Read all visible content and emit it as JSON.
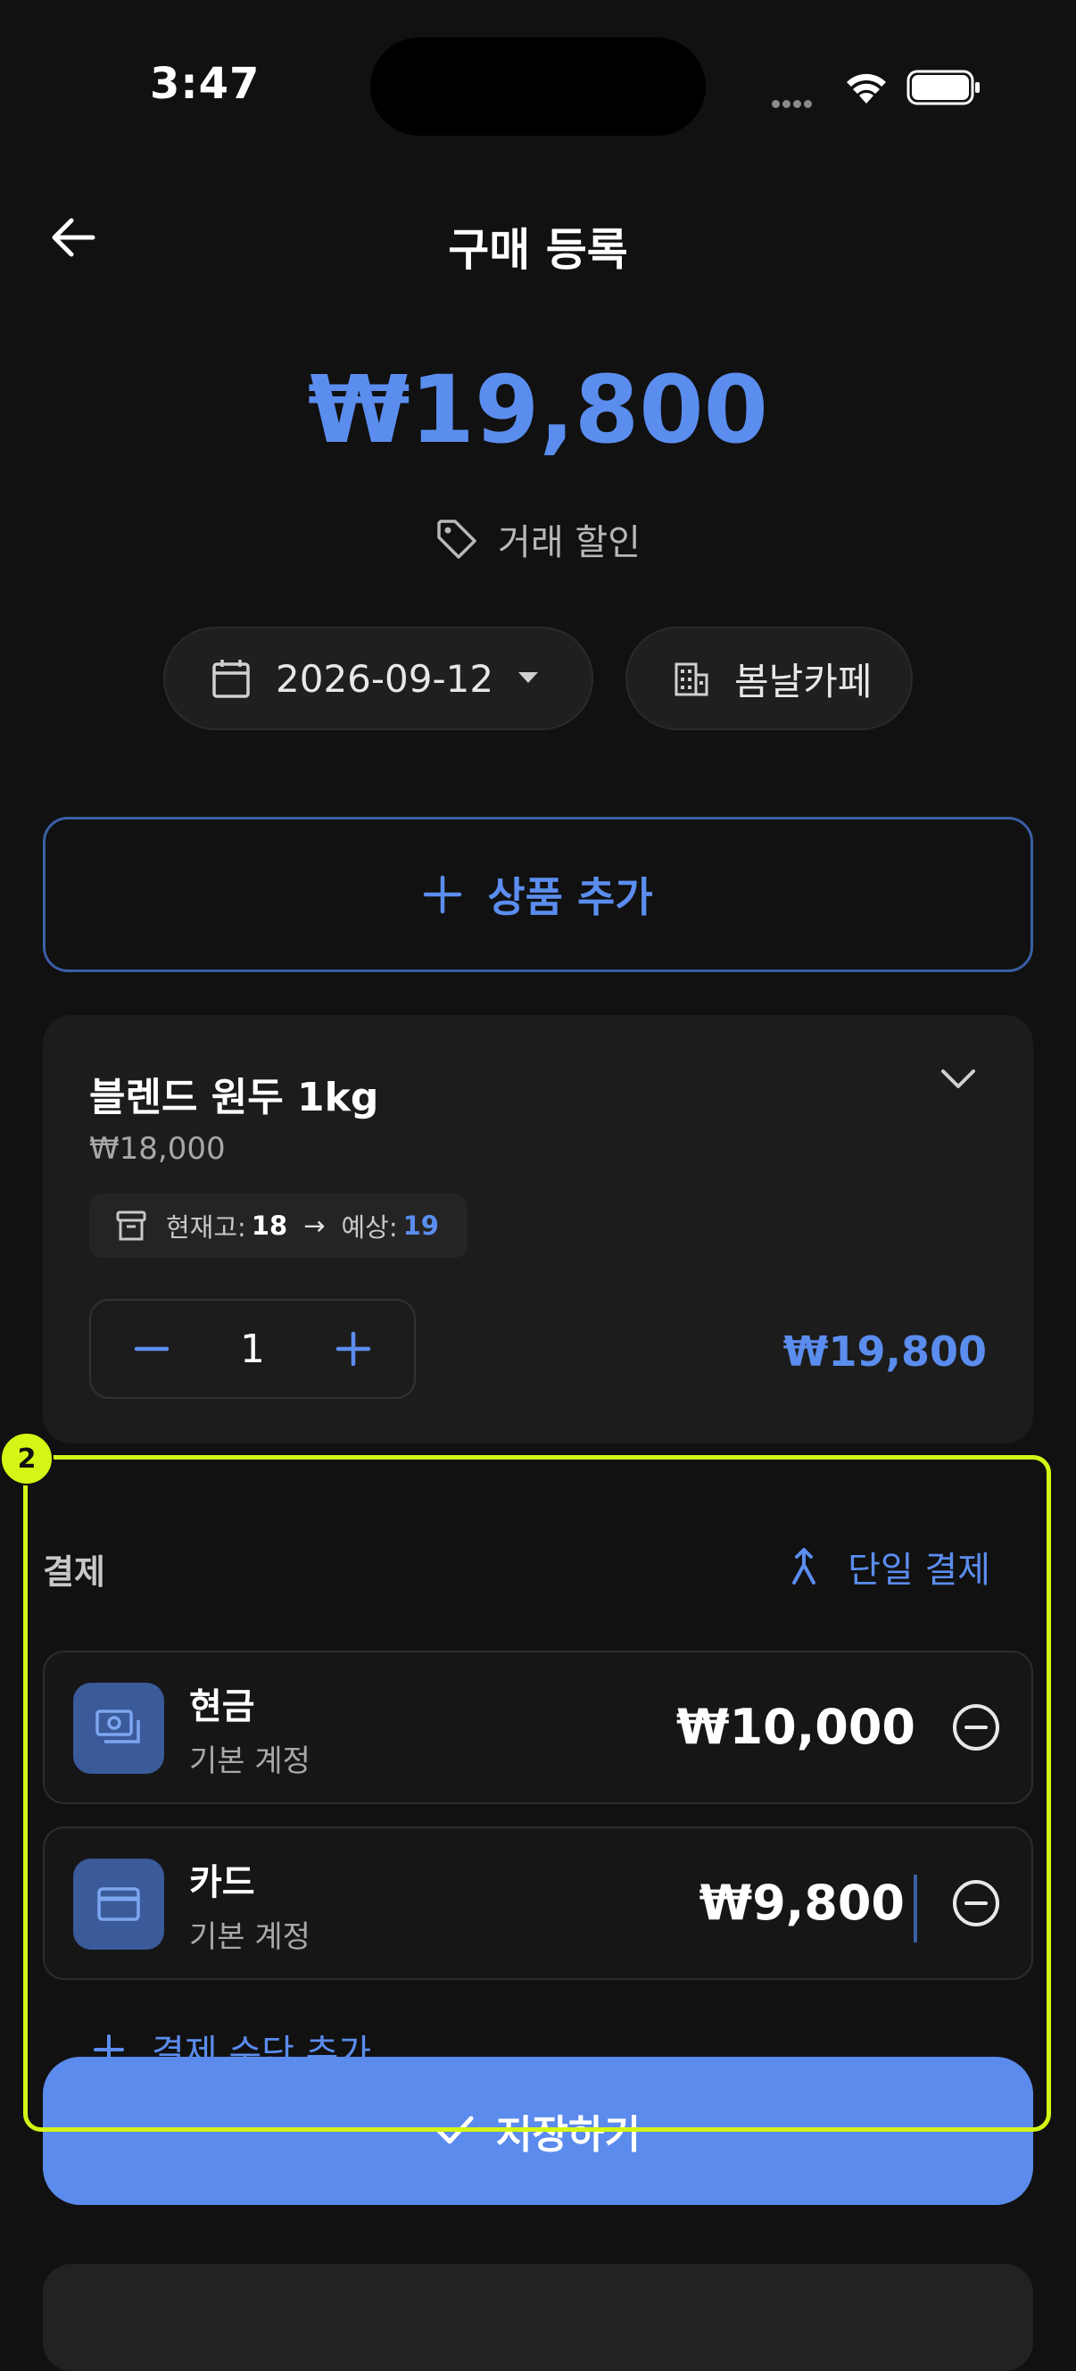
{
  "status_bar": {
    "time": "3:47"
  },
  "header": {
    "title": "구매 등록"
  },
  "total": {
    "amount": "₩19,800",
    "discount_label": "거래 할인"
  },
  "chips": {
    "date": "2026-09-12",
    "store": "봄날카페"
  },
  "add_product": {
    "label": "상품 추가"
  },
  "product": {
    "name": "블렌드 원두 1kg",
    "price": "₩18,000",
    "stock_label": "현재고:",
    "stock_value": "18",
    "expected_label": "예상:",
    "expected_value": "19",
    "quantity": "1",
    "line_total": "₩19,800"
  },
  "payment": {
    "label": "결제",
    "single_label": "단일 결제",
    "methods": [
      {
        "name": "현금",
        "account": "기본 계정",
        "amount": "₩10,000"
      },
      {
        "name": "카드",
        "account": "기본 계정",
        "amount": "₩9,800"
      }
    ],
    "add_method_label": "결제 수단 추가"
  },
  "save": {
    "label": "저장하기"
  },
  "annotation": {
    "badge": "2"
  },
  "colors": {
    "accent": "#5b8def",
    "highlight": "#d4f515",
    "background": "#111111"
  }
}
